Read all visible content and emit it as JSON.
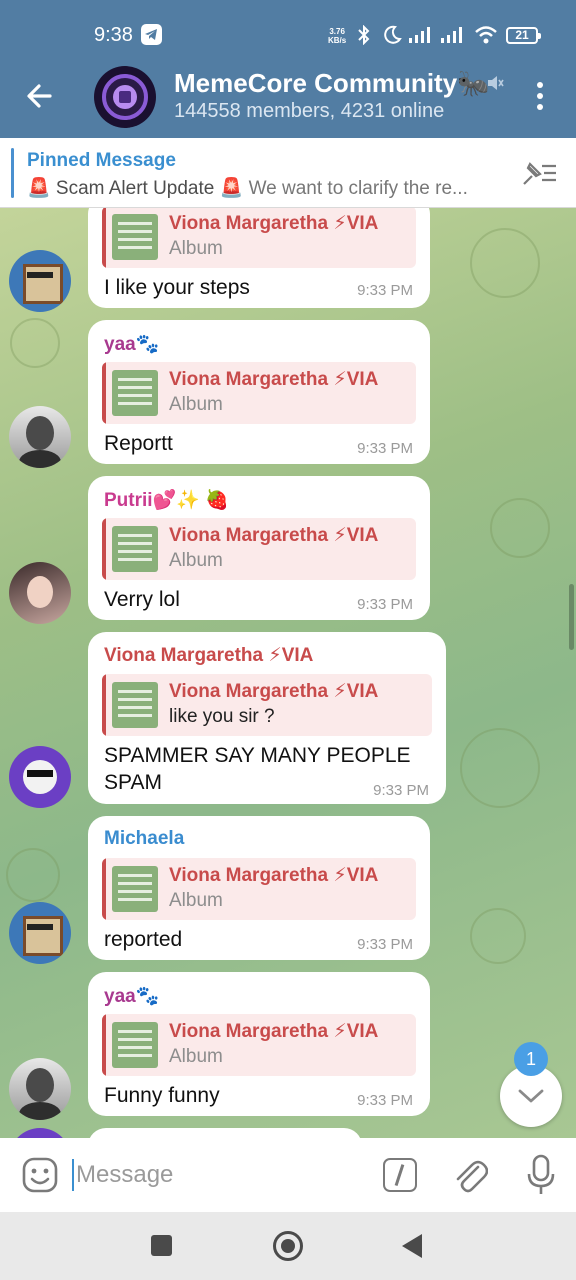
{
  "status": {
    "time": "9:38",
    "net_speed_value": "3.76",
    "net_speed_unit": "KB/s",
    "battery": "21"
  },
  "header": {
    "title": "MemeCore Community🐜",
    "subtitle": "144558 members, 4231 online"
  },
  "pinned": {
    "title": "Pinned Message",
    "alert": "🚨 Scam Alert Update 🚨",
    "text": "We want to clarify the re..."
  },
  "messages": [
    {
      "sender": "",
      "reply_name": "Viona Margaretha ⚡VIA",
      "reply_sub": "Album",
      "text": "I like your steps",
      "time": "9:33 PM"
    },
    {
      "sender": "yaa🐾",
      "sender_color": "#a8398f",
      "reply_name": "Viona Margaretha ⚡VIA",
      "reply_sub": "Album",
      "text": "Reportt",
      "time": "9:33 PM"
    },
    {
      "sender": "Putrii💕✨ 🍓",
      "sender_color": "#c93b8f",
      "reply_name": "Viona Margaretha ⚡VIA",
      "reply_sub": "Album",
      "text": "Verry lol",
      "time": "9:33 PM"
    },
    {
      "sender": "Viona Margaretha ⚡VIA",
      "sender_color": "#c84b4b",
      "reply_name": "Viona Margaretha ⚡VIA",
      "reply_sub": "like you sir ?",
      "text_line1": "SPAMMER SAY MANY PEOPLE",
      "text_line2": "SPAM",
      "time": "9:33 PM"
    },
    {
      "sender": "Michaela",
      "sender_color": "#3a8ccf",
      "reply_name": "Viona Margaretha ⚡VIA",
      "reply_sub": "Album",
      "text": "reported",
      "time": "9:33 PM"
    },
    {
      "sender": "yaa🐾",
      "sender_color": "#a8398f",
      "reply_name": "Viona Margaretha ⚡VIA",
      "reply_sub": "Album",
      "text": "Funny funny",
      "time": "9:33 PM"
    }
  ],
  "unread_count": "1",
  "input": {
    "placeholder": "Message"
  },
  "colors": {
    "header_bg": "#527da3",
    "reply_accent": "#c84b4b",
    "pinned_accent": "#3a8fd0",
    "badge": "#4a9fe5"
  },
  "icons": [
    "telegram-icon",
    "bluetooth-icon",
    "moon-icon",
    "signal-icon",
    "wifi-icon",
    "battery-icon",
    "back-arrow-icon",
    "mute-icon",
    "more-vert-icon",
    "pin-list-icon",
    "chevron-down-icon",
    "emoji-icon",
    "bot-command-icon",
    "attach-icon",
    "mic-icon",
    "recents-icon",
    "home-icon",
    "nav-back-icon"
  ]
}
